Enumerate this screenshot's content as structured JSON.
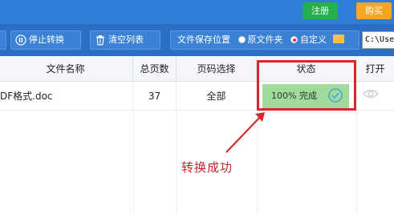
{
  "topbar": {
    "register_label": "注册",
    "buy_label": "购买"
  },
  "toolbar": {
    "stop_label": "停止转换",
    "clear_label": "清空列表",
    "save_location_label": "文件保存位置",
    "option_original": "原文件夹",
    "option_custom": "自定义",
    "path_value": "C:\\User"
  },
  "table": {
    "headers": {
      "name": "文件名称",
      "pages": "总页数",
      "page_select": "页码选择",
      "status": "状态",
      "open": "打开"
    },
    "rows": [
      {
        "name": "DF格式.doc",
        "pages": "37",
        "page_select": "全部",
        "status": "100% 完成"
      }
    ]
  },
  "annotation": {
    "text": "转换成功"
  },
  "colors": {
    "highlight": "#d9262a",
    "status_bg": "#9fdc9b",
    "toolbar": "#2a6fc6",
    "register": "#22b14c",
    "buy": "#f5a623"
  }
}
